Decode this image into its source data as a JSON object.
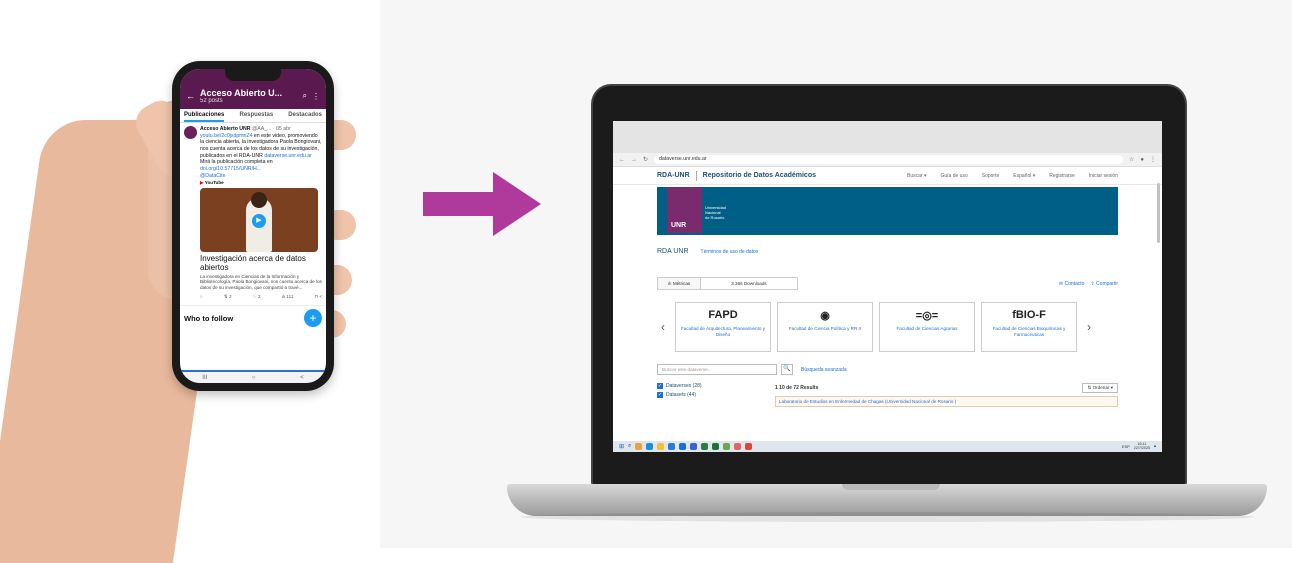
{
  "phone": {
    "header": {
      "title": "Acceso Abierto U...",
      "subtitle": "52 posts"
    },
    "tabs": [
      {
        "label": "Publicaciones"
      },
      {
        "label": "Respuestas"
      },
      {
        "label": "Destacados"
      }
    ],
    "post": {
      "author": "Acceso Abierto UNR",
      "handle": "@AA_... · 05 abr",
      "link1": "youtu.be/2c0jxdpmnZ4",
      "text1": " en este video, promoviendo la ciencia abierta, la investigadora Paola Bongiovani, nos cuenta acerca de los datos de su investigación, publicados en el RDA-UNR",
      "link2": "dataverse.unr.edu.ar",
      "text2": "Mirá la publicación completa en ",
      "link3": "doi.org/10.57715/UNR/H...",
      "link4": "@DataCite",
      "yt_label": "YouTube",
      "card_title": "Investigación acerca de datos abiertos",
      "card_desc": "La investigadora en Ciencias de la Información y Bibliotecología, Paola Bongiovani, nos cuenta acerca de los datos de su investigación, que compartió a travé...",
      "actions": [
        "○",
        "⇅ 2",
        "♡ 2",
        "ılı 111",
        "⊓ <"
      ]
    },
    "who_to_follow": "Who to follow",
    "fab": "+",
    "navbar": [
      "III",
      "○",
      "<"
    ]
  },
  "browser": {
    "url": "dataverse.unr.edu.ar"
  },
  "site": {
    "brand": "RDA-UNR",
    "brand_full": "Repositorio de Datos Académicos",
    "nav": [
      "Buscar ▾",
      "Guía de uso",
      "Soporte",
      "Español ▾",
      "Registrarse",
      "Iniciar sesión"
    ],
    "banner_logo": "UNR",
    "banner_name": [
      "Universidad",
      "Nacional",
      "de Rosario"
    ],
    "crumb_main": "RDA UNR",
    "crumb_link": "Términos de uso de datos",
    "metrics_tab": "ılı Métricas",
    "metrics_value": "3.366 Downloads",
    "contact": "✉ Contacto",
    "share": "⇪ Compartir",
    "carousel": [
      {
        "logo": "FAPD",
        "label": "Facultad de Arquitectura, Planeamiento y Diseño"
      },
      {
        "logo": "◉",
        "label": "Facultad de Ciencia Política y RR II"
      },
      {
        "logo": "=◎=",
        "label": "Facultad de Ciencias Agrarias"
      },
      {
        "logo": "fBIO-F",
        "label": "Facultad de Ciencias Bioquímicas y Farmacéuticas"
      }
    ],
    "search_placeholder": "Buscar este dataverse...",
    "search_icon": "🔍",
    "advanced": "Búsqueda avanzada",
    "facets": [
      {
        "label": "Dataverses (28)"
      },
      {
        "label": "Datasets (44)"
      }
    ],
    "results_count": "1 10 de 72 Results",
    "sort": "⇅ Ordenar ▾",
    "first_result": "Laboratorio de Estudios en Enfermedad de Chagas (Universidad Nacional de Rosario )"
  },
  "taskbar": {
    "lang": "ESP",
    "time": "16:11",
    "date": "22/7/2025"
  },
  "colors": {
    "twitter_header": "#5a1a4f",
    "arrow": "#b03a9c",
    "banner": "#005f86",
    "unr_purple": "#7a2b6e",
    "link_blue": "#1d6fd8"
  }
}
